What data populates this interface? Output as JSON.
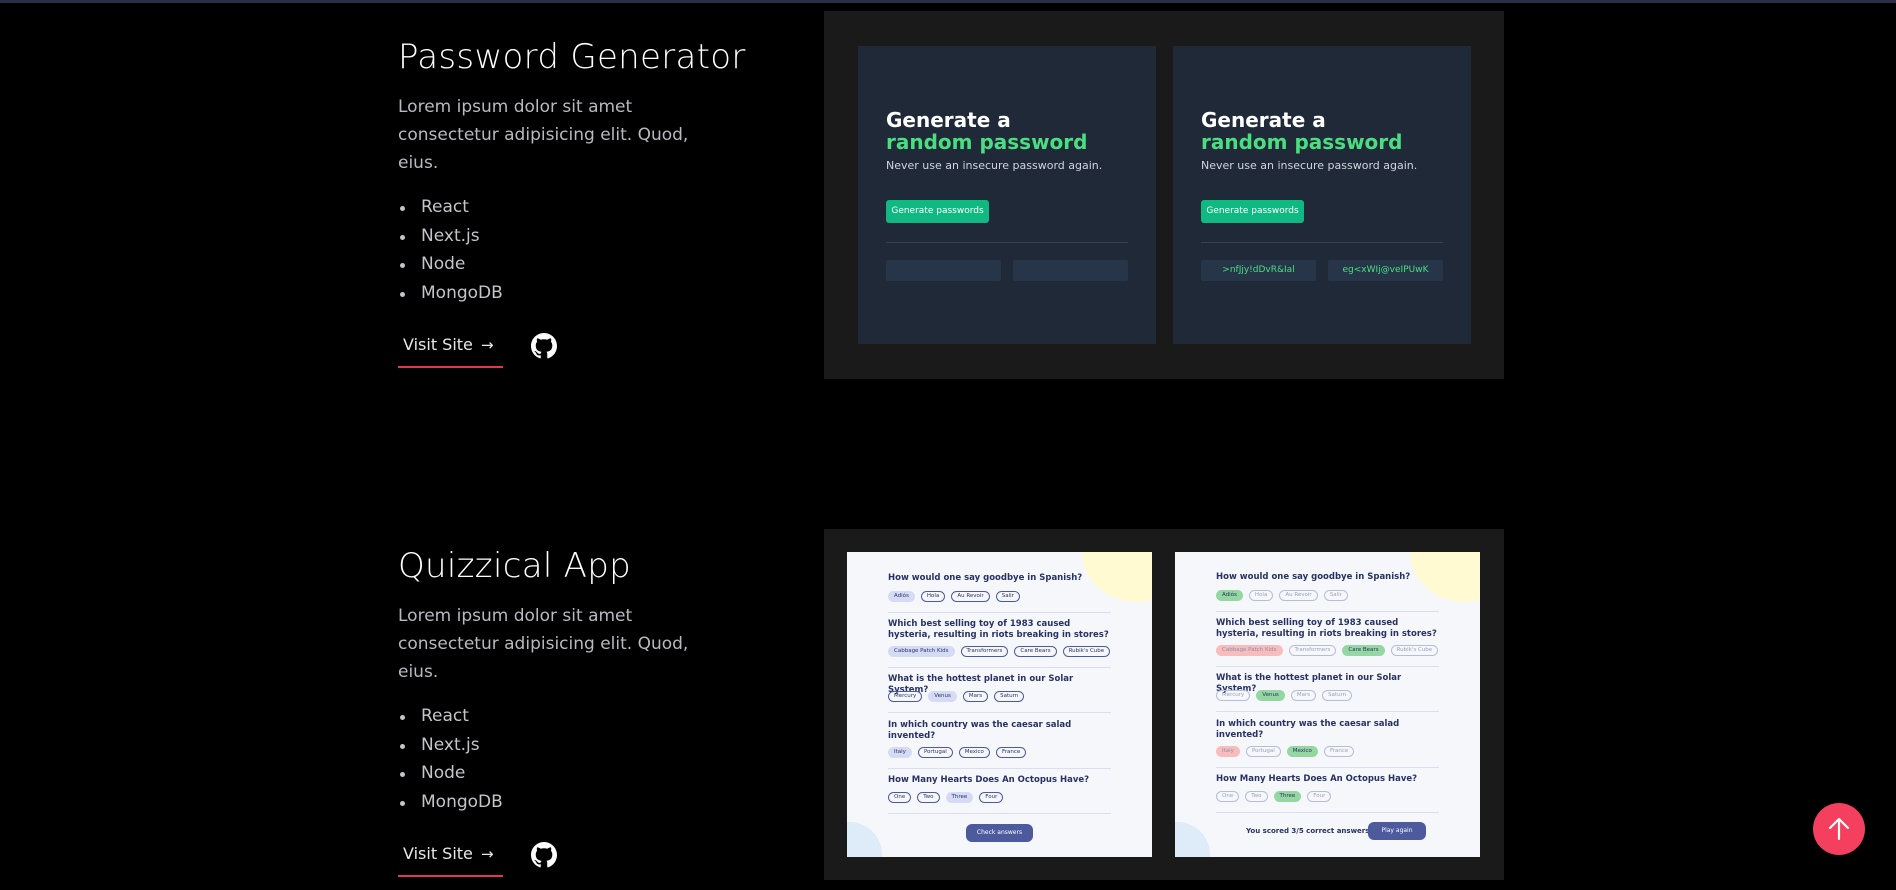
{
  "projects": [
    {
      "title": "Password Generator",
      "description": "Lorem ipsum dolor sit amet consectetur adipisicing elit. Quod, eius.",
      "stack": [
        "React",
        "Next.js",
        "Node",
        "MongoDB"
      ],
      "visit_label": "Visit Site",
      "visit_arrow": "→",
      "preview": {
        "heading_line1": "Generate a",
        "heading_line2": "random password",
        "subtitle": "Never use an insecure password again.",
        "button_label": "Generate passwords",
        "passwords": [
          ">nfJjy!dDvR&Ial",
          "eg<xWIj@veIPUwK"
        ],
        "colors": {
          "card_bg": "#1f2937",
          "accent": "#4ade80",
          "button": "#10b981"
        }
      }
    },
    {
      "title": "Quizzical App",
      "description": "Lorem ipsum dolor sit amet consectetur adipisicing elit. Quod, eius.",
      "stack": [
        "React",
        "Next.js",
        "Node",
        "MongoDB"
      ],
      "visit_label": "Visit Site",
      "visit_arrow": "→",
      "preview": {
        "questions": [
          {
            "q": "How would one say goodbye in Spanish?",
            "options": [
              "Adiós",
              "Hola",
              "Au Revoir",
              "Salir"
            ]
          },
          {
            "q": "Which best selling toy of 1983 caused hysteria, resulting in riots breaking in stores?",
            "options": [
              "Cabbage Patch Kids",
              "Transformers",
              "Care Bears",
              "Rubik's Cube"
            ]
          },
          {
            "q": "What is the hottest planet in our Solar System?",
            "options": [
              "Mercury",
              "Venus",
              "Mars",
              "Saturn"
            ]
          },
          {
            "q": "In which country was the caesar salad invented?",
            "options": [
              "Italy",
              "Portugal",
              "Mexico",
              "France"
            ]
          },
          {
            "q": "How Many Hearts Does An Octopus Have?",
            "options": [
              "One",
              "Two",
              "Three",
              "Four"
            ]
          }
        ],
        "check_label": "Check answers",
        "score_text": "You scored 3/5 correct answers",
        "play_again_label": "Play again",
        "colors": {
          "card_bg": "#f5f7fb",
          "primary": "#4d5b9e",
          "correct": "#94d7a2",
          "wrong": "#f8bcbc"
        }
      }
    }
  ],
  "scroll_top_icon": "arrow-up-icon",
  "github_icon": "github-icon",
  "colors": {
    "page_bg": "#000000",
    "underline": "#e3354f",
    "scroll_top_bg": "#f43f5e"
  }
}
